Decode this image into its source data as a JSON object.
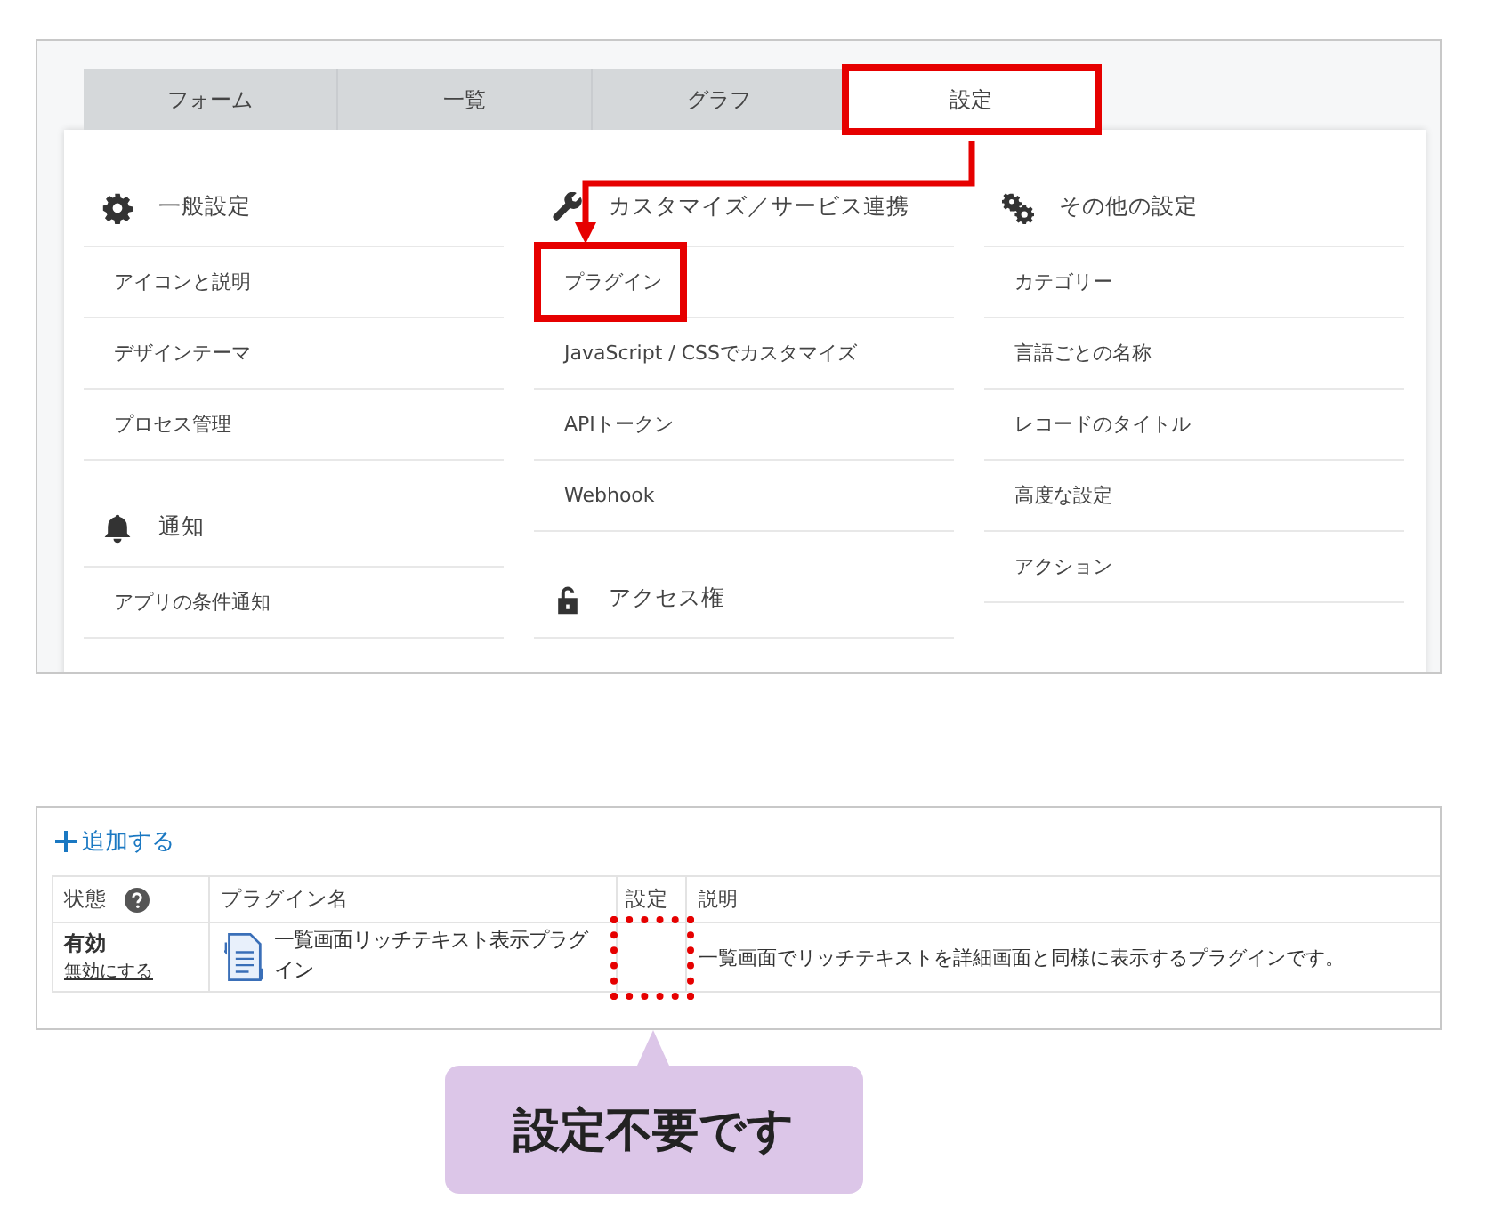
{
  "settings_tabs": [
    {
      "label": "フォーム",
      "selected": false,
      "highlighted": false
    },
    {
      "label": "一覧",
      "selected": false,
      "highlighted": false
    },
    {
      "label": "グラフ",
      "selected": false,
      "highlighted": false
    },
    {
      "label": "設定",
      "selected": true,
      "highlighted": true
    }
  ],
  "settings_columns": [
    {
      "sections": [
        {
          "title": "一般設定",
          "kind": "gear",
          "items": [
            {
              "label": "アイコンと説明",
              "highlighted": false
            },
            {
              "label": "デザインテーマ",
              "highlighted": false
            },
            {
              "label": "プロセス管理",
              "highlighted": false
            }
          ]
        },
        {
          "title": "通知",
          "kind": "bell",
          "items": [
            {
              "label": "アプリの条件通知",
              "highlighted": false
            }
          ]
        }
      ]
    },
    {
      "sections": [
        {
          "title": "カスタマイズ／サービス連携",
          "kind": "wrench",
          "items": [
            {
              "label": "プラグイン",
              "highlighted": true
            },
            {
              "label": "JavaScript / CSSでカスタマイズ",
              "highlighted": false
            },
            {
              "label": "APIトークン",
              "highlighted": false
            },
            {
              "label": "Webhook",
              "highlighted": false
            }
          ]
        },
        {
          "title": "アクセス権",
          "kind": "lock"
        }
      ]
    },
    {
      "sections": [
        {
          "title": "その他の設定",
          "kind": "gears",
          "items": [
            {
              "label": "カテゴリー",
              "highlighted": false
            },
            {
              "label": "言語ごとの名称",
              "highlighted": false
            },
            {
              "label": "レコードのタイトル",
              "highlighted": false
            },
            {
              "label": "高度な設定",
              "highlighted": false
            },
            {
              "label": "アクション",
              "highlighted": false
            }
          ]
        }
      ]
    }
  ],
  "plugin_panel": {
    "add_link": "追加する",
    "columns": [
      "状態",
      "プラグイン名",
      "設定",
      "説明"
    ],
    "rows": [
      {
        "status": "有効",
        "toggle_link": "無効にする",
        "name": "一覧画面リッチテキスト表示プラグイン",
        "settings_highlighted": true,
        "description": "一覧画面でリッチテキストを詳細画面と同様に表示するプラグインです。"
      }
    ]
  },
  "callout": {
    "text": "設定不要です"
  }
}
